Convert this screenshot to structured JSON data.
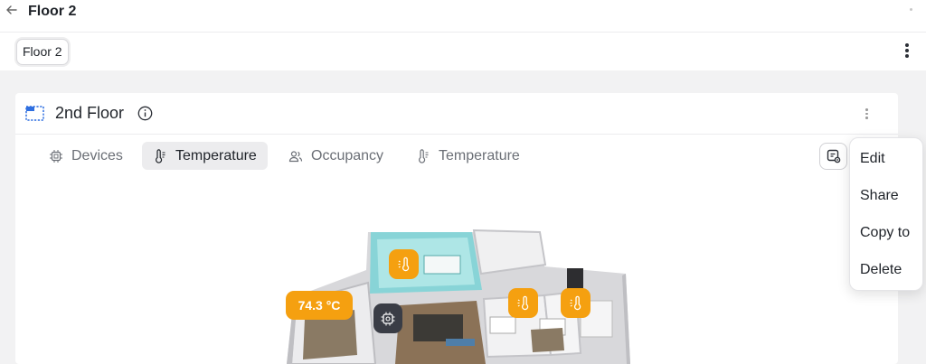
{
  "header": {
    "title": "Floor 2"
  },
  "subbar": {
    "chip_label": "Floor 2"
  },
  "card": {
    "title": "2nd Floor",
    "tabs": [
      {
        "label": "Devices",
        "icon": "chip-icon"
      },
      {
        "label": "Temperature",
        "icon": "thermometer-icon",
        "active": true
      },
      {
        "label": "Occupancy",
        "icon": "people-icon"
      },
      {
        "label": "Temperature",
        "icon": "thermometer-icon"
      }
    ]
  },
  "floorplan": {
    "temperature_label": "74.3 °C"
  },
  "context_menu": {
    "items": [
      "Edit",
      "Share",
      "Copy to",
      "Delete"
    ]
  },
  "colors": {
    "accent_orange": "#f5a010",
    "highlight_room": "#7fd4d6",
    "device_marker": "#3a3d46",
    "active_tab_bg": "#ececee"
  }
}
